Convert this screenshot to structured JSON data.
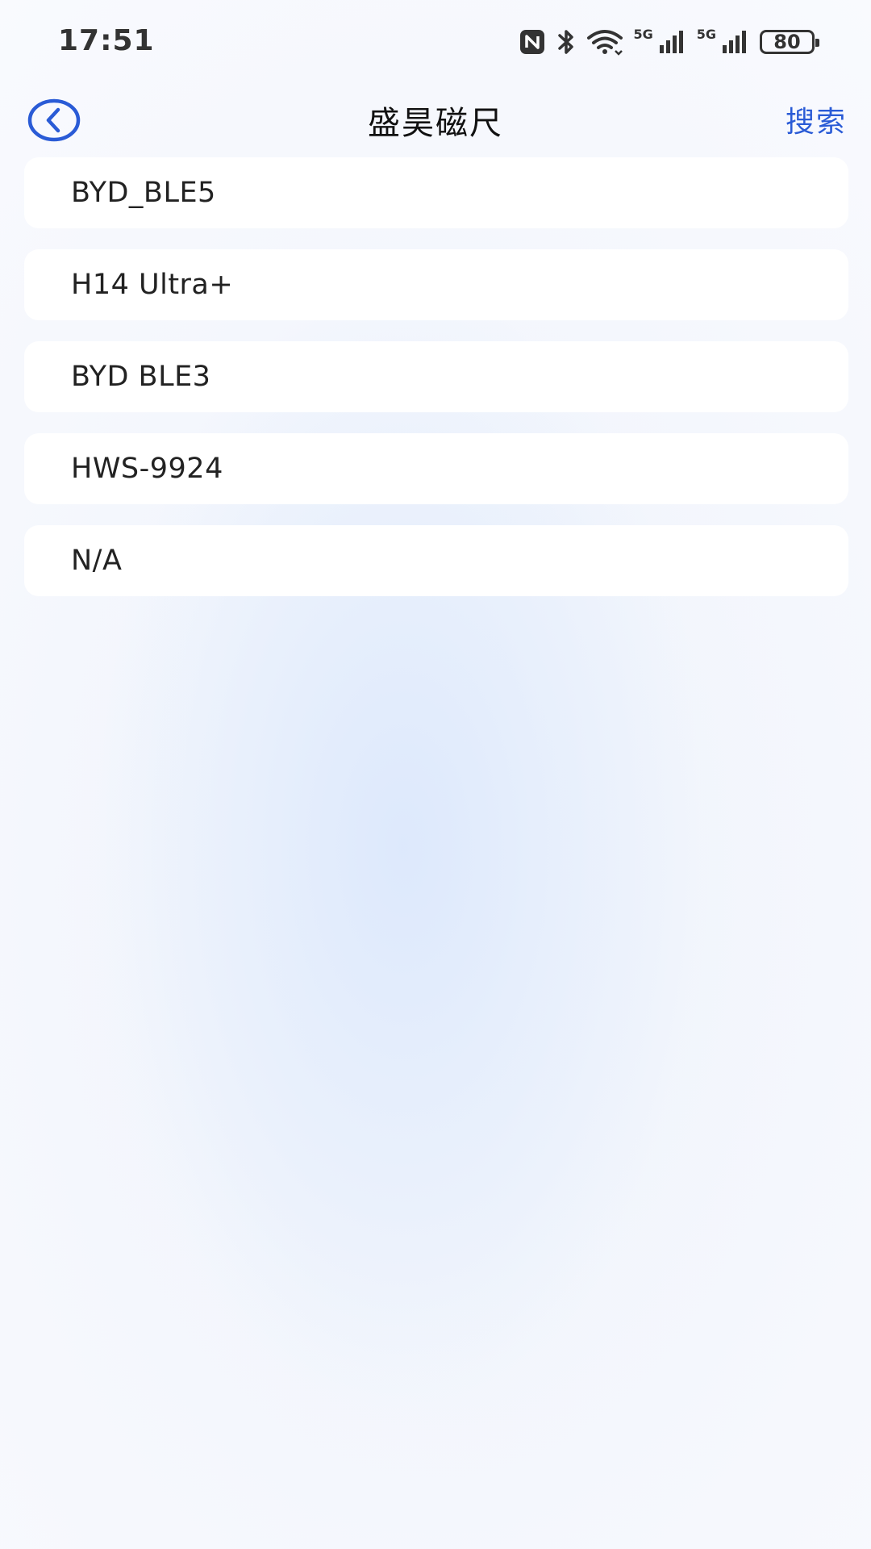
{
  "status_bar": {
    "time": "17:51",
    "network_1": "5G",
    "network_2": "5G",
    "battery": "80"
  },
  "header": {
    "title": "盛昊磁尺",
    "search_label": "搜索",
    "accent_color": "#2a5bd6"
  },
  "devices": [
    {
      "name": "BYD_BLE5"
    },
    {
      "name": "H14 Ultra+"
    },
    {
      "name": "BYD BLE3"
    },
    {
      "name": "HWS-9924"
    },
    {
      "name": "N/A"
    }
  ]
}
